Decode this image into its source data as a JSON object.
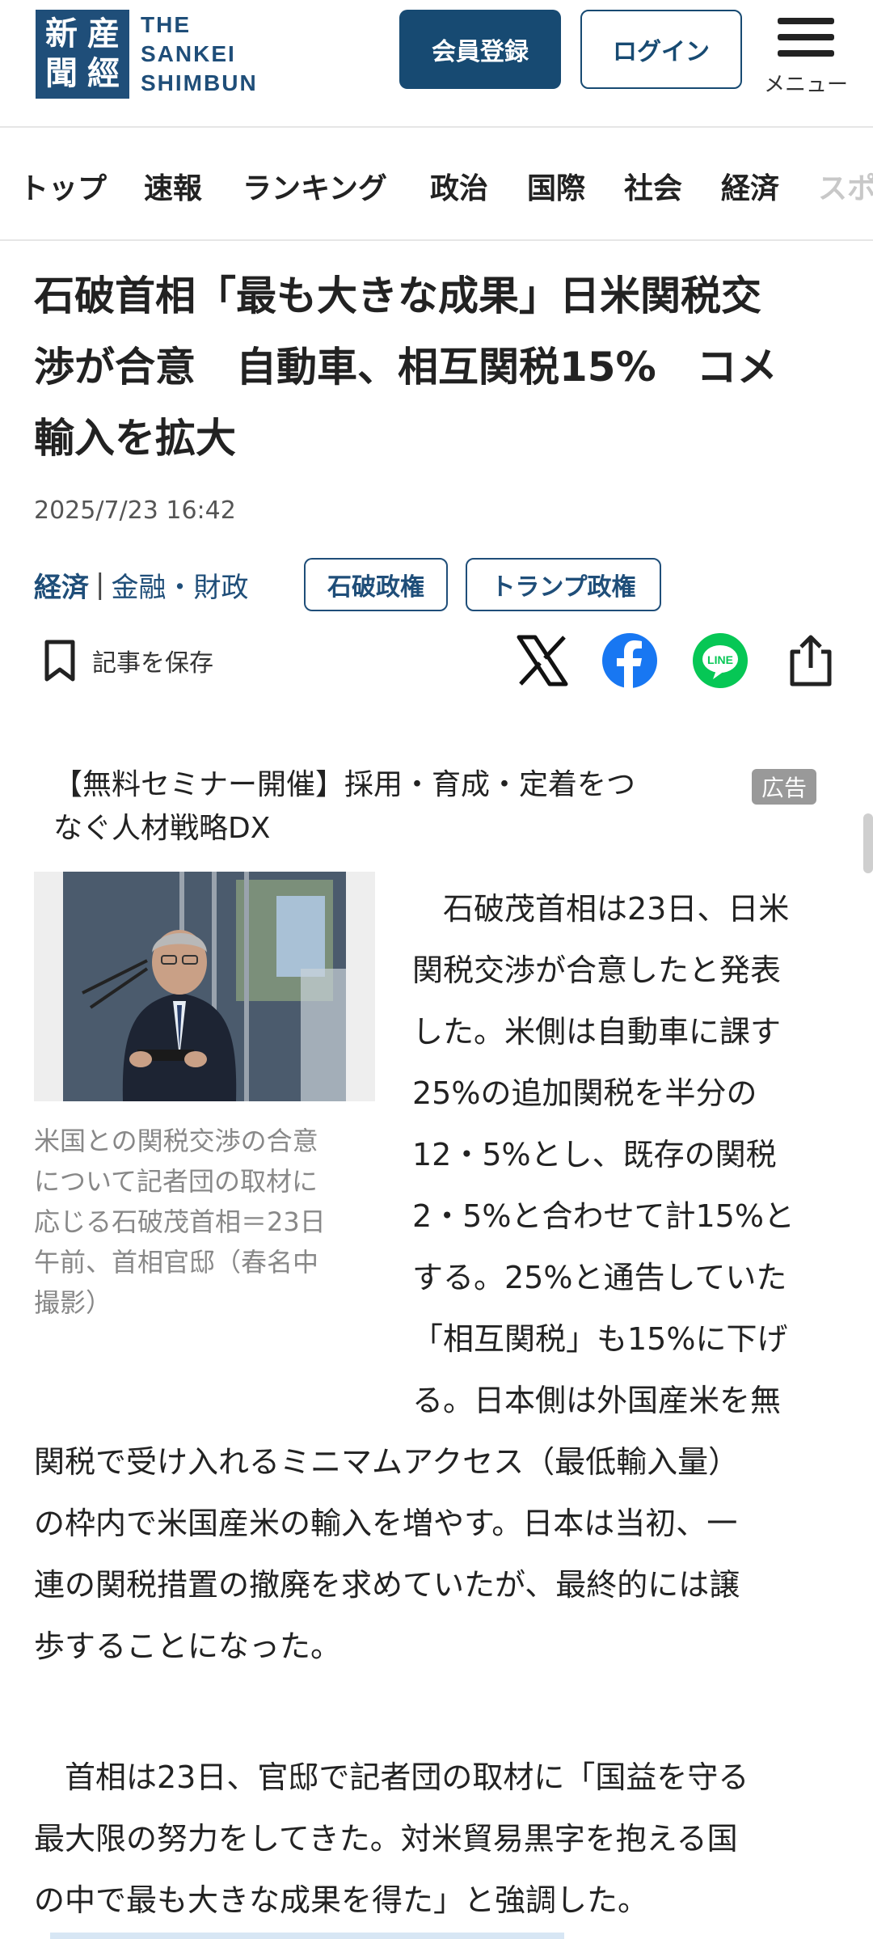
{
  "header": {
    "logo_kanji": [
      "産",
      "經",
      "新",
      "聞"
    ],
    "logo_text": [
      "THE",
      "SANKEI",
      "SHIMBUN"
    ],
    "register_label": "会員登録",
    "login_label": "ログイン",
    "menu_label": "メニュー"
  },
  "nav": {
    "items": [
      "トップ",
      "速報",
      "ランキング",
      "政治",
      "国際",
      "社会",
      "経済",
      "スポ"
    ]
  },
  "article": {
    "headline_lines": [
      "石破首相「最も大きな成果」日米関税交",
      "渉が合意　自動車、相互関税15%　コメ",
      "輸入を拡大"
    ],
    "date": "2025/7/23 16:42",
    "category_main": "経済",
    "category_sep": "|",
    "category_sub": "金融・財政",
    "tags": [
      "石破政権",
      "トランプ政権"
    ],
    "save_label": "記事を保存"
  },
  "ad": {
    "lines": [
      "【無料セミナー開催】採用・育成・定着をつ",
      "なぐ人材戦略DX"
    ],
    "badge": "広告"
  },
  "photo": {
    "caption_lines": [
      "米国との関税交渉の合意",
      "について記者団の取材に",
      "応じる石破茂首相＝23日",
      "午前、首相官邸（春名中",
      "撮影）"
    ]
  },
  "body": {
    "narrow_lines": [
      "　石破茂首相は23日、日米",
      "関税交渉が合意したと発表",
      "した。米側は自動車に課す",
      "25%の追加関税を半分の",
      "12・5%とし、既存の関税",
      "2・5%と合わせて計15%と",
      "する。25%と通告していた",
      "「相互関税」も15%に下げ",
      "る。日本側は外国産米を無"
    ],
    "wide_lines": [
      "関税で受け入れるミニマムアクセス（最低輸入量）",
      "の枠内で米国産米の輸入を増やす。日本は当初、一",
      "連の関税措置の撤廃を求めていたが、最終的には譲",
      "歩することになった。"
    ],
    "p2_lines": [
      "　首相は23日、官邸で記者団の取材に「国益を守る",
      "最大限の努力をしてきた。対米貿易黒字を抱える国",
      "の中で最も大きな成果を得た」と強調した。"
    ]
  },
  "colors": {
    "brand": "#1f4e79",
    "facebook": "#1877f2",
    "line": "#06c755"
  }
}
